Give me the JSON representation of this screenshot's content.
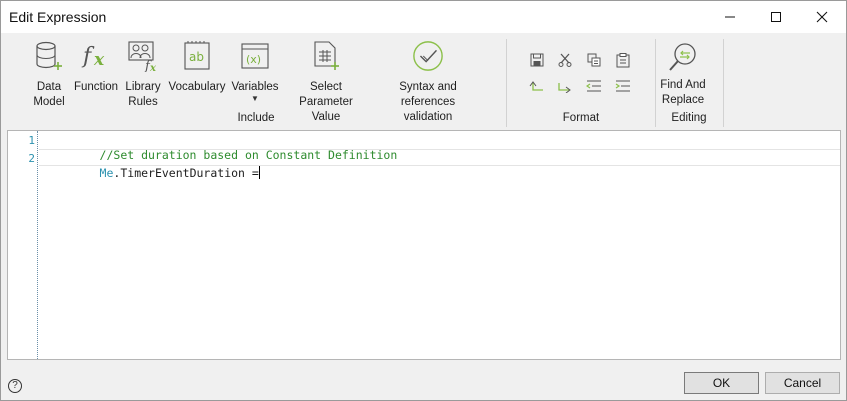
{
  "window": {
    "title": "Edit Expression",
    "minimize_icon": "minimize-icon",
    "maximize_icon": "maximize-icon",
    "close_icon": "close-icon"
  },
  "ribbon": {
    "include": {
      "group_label": "Include",
      "buttons": [
        {
          "label": "Data\nModel",
          "icon": "database-add-icon"
        },
        {
          "label": "Function",
          "icon": "function-fx-icon"
        },
        {
          "label": "Library\nRules",
          "icon": "library-rules-icon"
        },
        {
          "label": "Vocabulary",
          "icon": "vocabulary-icon"
        },
        {
          "label": "Variables",
          "icon": "variables-icon",
          "has_dropdown": true
        },
        {
          "label": "Select Parameter\nValue",
          "icon": "table-add-icon"
        },
        {
          "label": "Syntax and references\nvalidation",
          "icon": "check-circle-icon"
        }
      ]
    },
    "format": {
      "group_label": "Format",
      "tools": [
        "save-icon",
        "cut-icon",
        "copy-icon",
        "paste-icon",
        "undo-icon",
        "redo-icon",
        "outdent-icon",
        "indent-icon"
      ]
    },
    "editing": {
      "group_label": "Editing",
      "buttons": [
        {
          "label": "Find And\nReplace",
          "icon": "find-replace-icon"
        }
      ]
    }
  },
  "editor": {
    "lines": [
      {
        "number": "1",
        "comment": "//Set duration based on Constant Definition"
      },
      {
        "number": "2",
        "object": "Me",
        "dot": ".",
        "member": "TimerEventDuration =",
        "current": true
      }
    ]
  },
  "footer": {
    "help_label": "?",
    "ok_label": "OK",
    "cancel_label": "Cancel"
  },
  "colors": {
    "comment": "#2e8b2e",
    "keyword": "#2b91af",
    "icon_green": "#7ab03d",
    "icon_gray": "#555555"
  }
}
